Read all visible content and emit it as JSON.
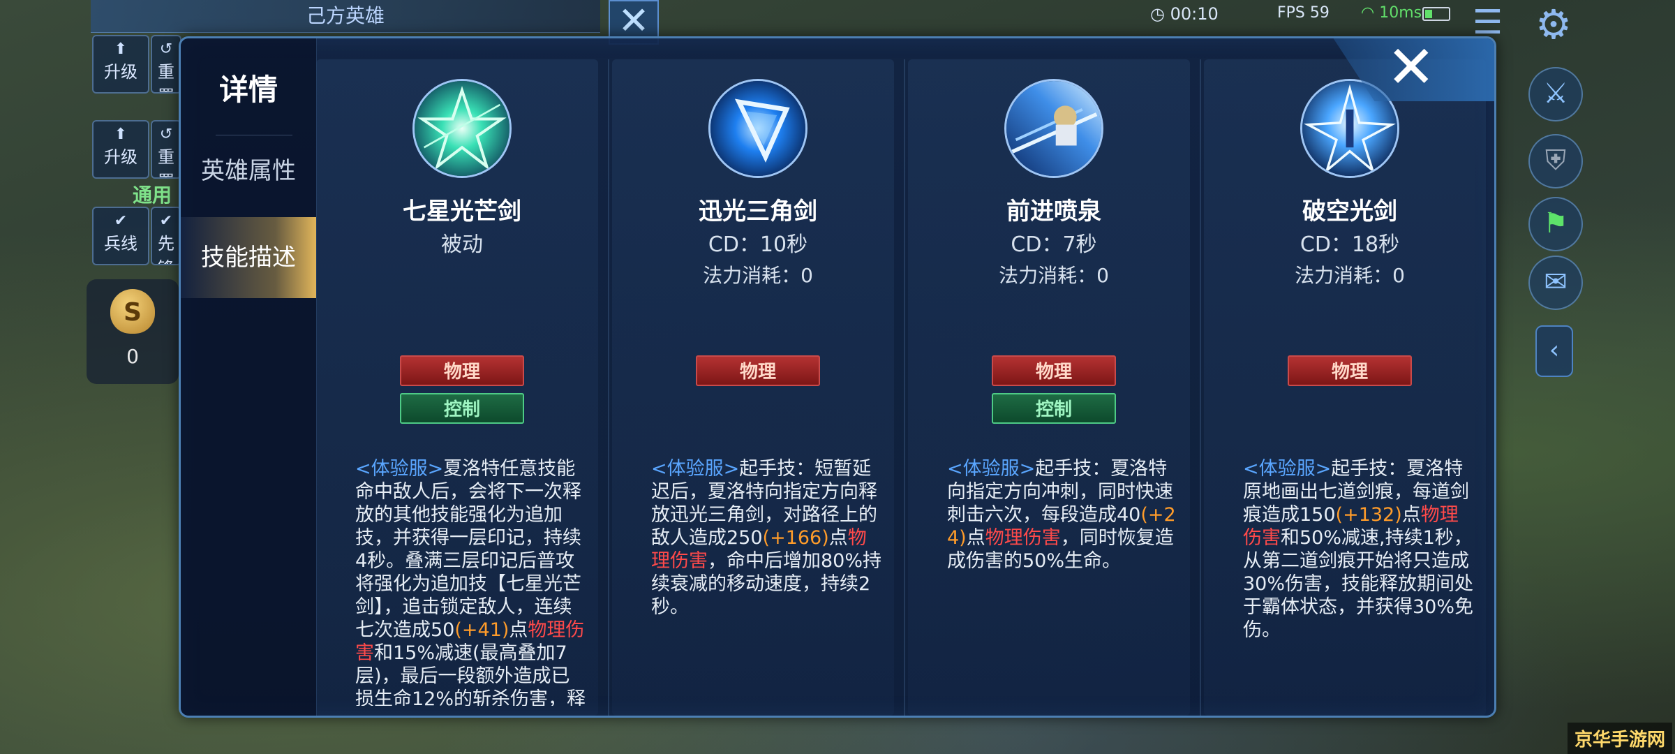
{
  "background": {
    "team_title": "己方英雄",
    "buttons": [
      {
        "label": "升级",
        "icon": "up-arrow-icon"
      },
      {
        "label": "重置",
        "icon": "reset-icon"
      },
      {
        "label": "升级",
        "icon": "up-arrow-icon"
      },
      {
        "label": "重置",
        "icon": "reset-icon"
      },
      {
        "label": "兵线",
        "icon": "check-icon"
      },
      {
        "label": "先锋",
        "icon": "check-icon"
      }
    ],
    "general_label": "通用",
    "money_symbol": "S",
    "money_count": "0",
    "timer": "00:10",
    "fps": "FPS 59",
    "ping": "10ms"
  },
  "panel": {
    "title": "详情",
    "tabs": [
      {
        "label": "英雄属性",
        "active": false
      },
      {
        "label": "技能描述",
        "active": true
      }
    ],
    "close_glyph": "✕"
  },
  "skills": [
    {
      "name": "七星光芒剑",
      "subtitle": "被动",
      "cost": "",
      "tags": [
        {
          "label": "物理",
          "color": "#b43232"
        },
        {
          "label": "控制",
          "color": "#1e6b44"
        }
      ],
      "desc": [
        {
          "t": "<体验服>",
          "c": "tip"
        },
        {
          "t": "夏洛特任意技能命中敌人后，会将下一次释放的其他技能强化为追加技，并获得一层印记，持续4秒。叠满三层印记后普攻将强化为追加技【七星光芒剑】，追击锁定敌人，连续七次造成50",
          "c": ""
        },
        {
          "t": "(+41)",
          "c": "bonus"
        },
        {
          "t": "点",
          "c": ""
        },
        {
          "t": "物理伤害",
          "c": "dmg"
        },
        {
          "t": "和15%减速(最高叠加7层)，最后一段额外造成已损生命12%的斩杀伤害，释放期间获",
          "c": ""
        }
      ]
    },
    {
      "name": "迅光三角剑",
      "subtitle": "CD：10秒",
      "cost": "法力消耗：0",
      "tags": [
        {
          "label": "物理",
          "color": "#b43232"
        }
      ],
      "desc": [
        {
          "t": "<体验服>",
          "c": "tip"
        },
        {
          "t": "起手技：短暂延迟后，夏洛特向指定方向释放迅光三角剑，对路径上的敌人造成250",
          "c": ""
        },
        {
          "t": "(+166)",
          "c": "bonus"
        },
        {
          "t": "点",
          "c": ""
        },
        {
          "t": "物理伤害",
          "c": "dmg"
        },
        {
          "t": "，命中后增加80%持续衰减的移动速度，持续2秒。",
          "c": ""
        }
      ]
    },
    {
      "name": "前进喷泉",
      "subtitle": "CD：7秒",
      "cost": "法力消耗：0",
      "tags": [
        {
          "label": "物理",
          "color": "#b43232"
        },
        {
          "label": "控制",
          "color": "#1e6b44"
        }
      ],
      "desc": [
        {
          "t": "<体验服>",
          "c": "tip"
        },
        {
          "t": "起手技：夏洛特向指定方向冲刺，同时快速刺击六次，每段造成40",
          "c": ""
        },
        {
          "t": "(+24)",
          "c": "bonus"
        },
        {
          "t": "点",
          "c": ""
        },
        {
          "t": "物理伤害",
          "c": "dmg"
        },
        {
          "t": "，同时恢复造成伤害的50%生命。",
          "c": ""
        }
      ]
    },
    {
      "name": "破空光剑",
      "subtitle": "CD：18秒",
      "cost": "法力消耗：0",
      "tags": [
        {
          "label": "物理",
          "color": "#b43232"
        }
      ],
      "desc": [
        {
          "t": "<体验服>",
          "c": "tip"
        },
        {
          "t": "起手技：夏洛特原地画出七道剑痕，每道剑痕造成150",
          "c": ""
        },
        {
          "t": "(+132)",
          "c": "bonus"
        },
        {
          "t": "点",
          "c": ""
        },
        {
          "t": "物理伤害",
          "c": "dmg"
        },
        {
          "t": "和50%减速,持续1秒，从第二道剑痕开始将只造成30%伤害，技能释放期间处于霸体状态，并获得30%免伤。",
          "c": ""
        }
      ]
    }
  ],
  "watermark": "京华手游网"
}
